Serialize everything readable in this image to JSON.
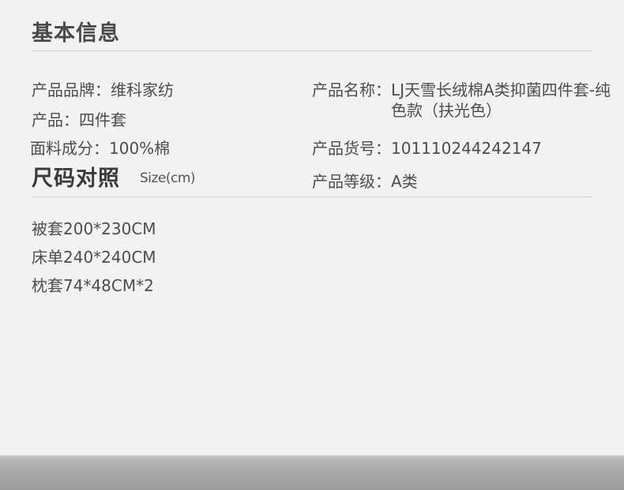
{
  "header": {
    "title": "基本信息"
  },
  "info": {
    "brand": {
      "label": "产品品牌：",
      "value": "维科家纺"
    },
    "product": {
      "label": "产品：",
      "value": "四件套"
    },
    "fabric": {
      "label": "面料成分：",
      "value": "100%棉"
    },
    "name": {
      "label": "产品名称：",
      "value": "LJ天雪长绒棉A类抑菌四件套-纯色款（扶光色）"
    },
    "sku": {
      "label": "产品货号：",
      "value": "101110244242147"
    },
    "grade": {
      "label": "产品等级：",
      "value": "A类"
    }
  },
  "size_chart": {
    "title": "尺码对照",
    "subtitle": "Size(cm)",
    "items": [
      "被套200*230CM",
      "床单240*240CM",
      "枕套74*48CM*2"
    ]
  }
}
